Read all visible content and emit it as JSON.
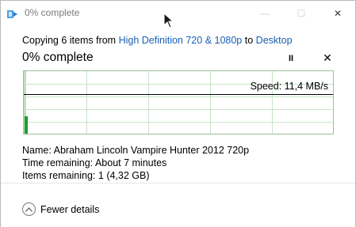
{
  "window": {
    "title": "0% complete",
    "minimize_glyph": "—",
    "maximize_glyph": "☐",
    "close_glyph": "✕"
  },
  "copy": {
    "prefix": "Copying 6 items from",
    "source": "High Definition 720 & 1080p",
    "middle": "to",
    "destination": "Desktop"
  },
  "progress": {
    "heading": "0% complete",
    "percent": 0,
    "pause_glyph": "II",
    "cancel_glyph": "✕"
  },
  "graph": {
    "speed_label": "Speed: 11,4 MB/s"
  },
  "details": {
    "name_label": "Name:",
    "name_value": "Abraham Lincoln Vampire Hunter 2012 720p",
    "time_label": "Time remaining:",
    "time_value": "About 7 minutes",
    "items_label": "Items remaining:",
    "items_value": "1 (4,32 GB)"
  },
  "footer": {
    "toggle_label": "Fewer details"
  },
  "colors": {
    "accent_link": "#1a5fb4",
    "graph_bar": "#1e9e2e",
    "graph_grid": "#c9e3c9"
  },
  "icons": {
    "app": "copy-transfer-icon",
    "toggle": "chevron-up-circle-icon",
    "cursor": "mouse-pointer-icon"
  }
}
